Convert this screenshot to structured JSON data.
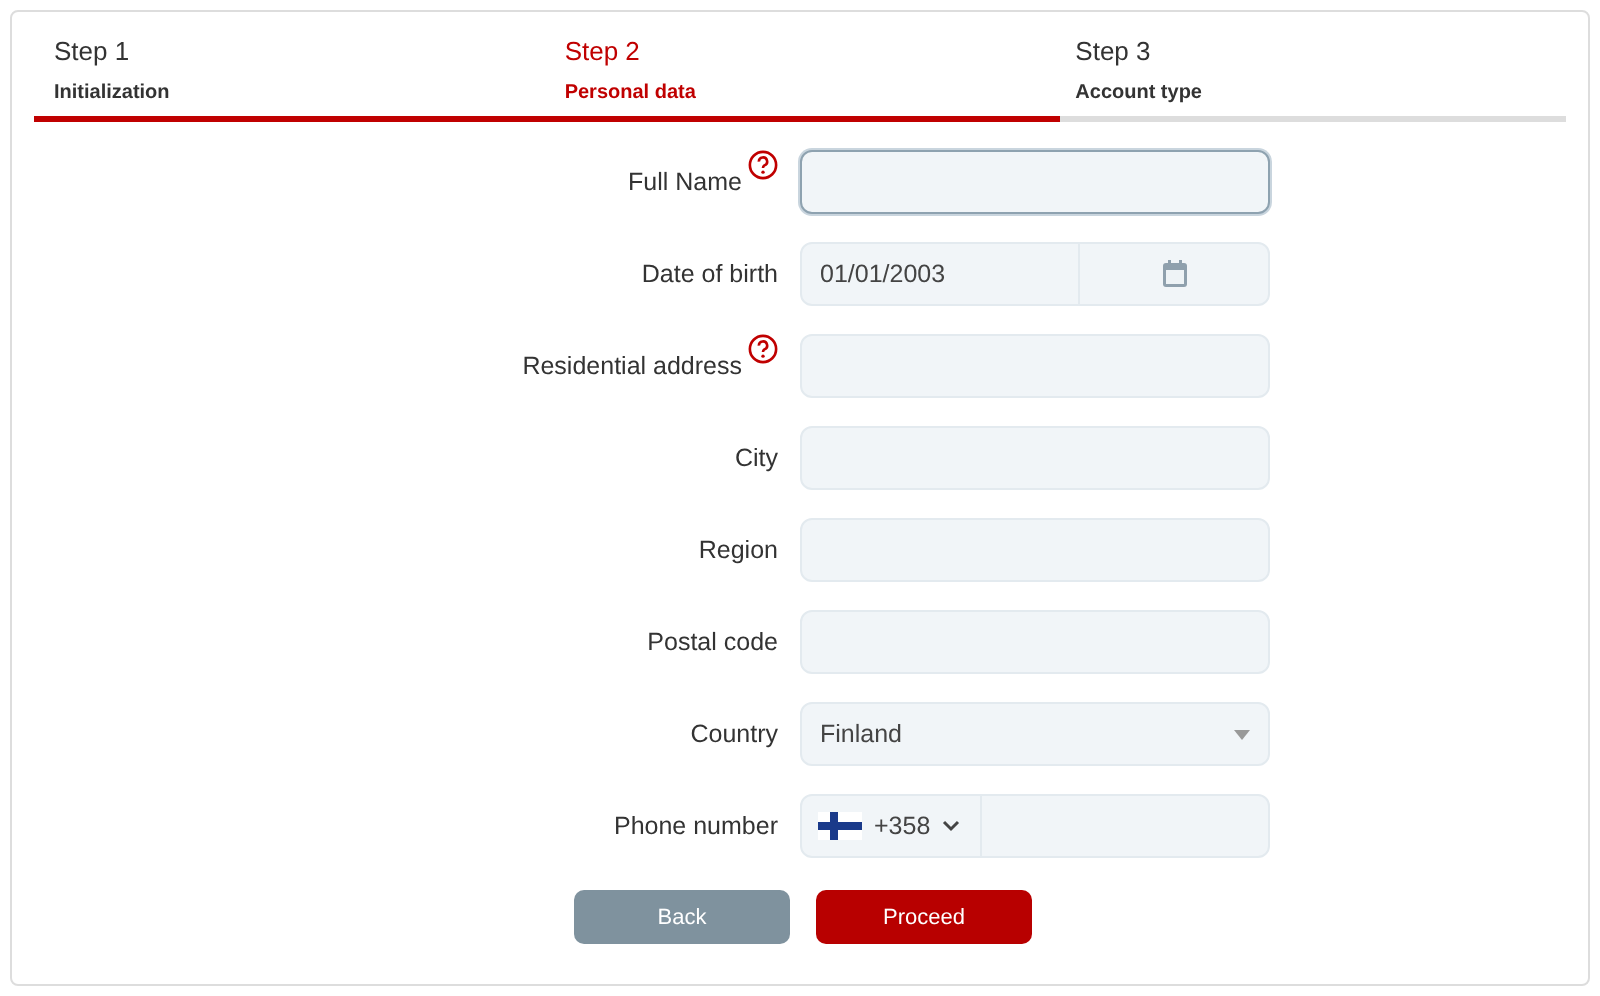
{
  "steps": [
    {
      "title": "Step 1",
      "subtitle": "Initialization",
      "selected": false
    },
    {
      "title": "Step 2",
      "subtitle": "Personal data",
      "selected": true
    },
    {
      "title": "Step 3",
      "subtitle": "Account type",
      "selected": false
    }
  ],
  "progress": {
    "level": 0.67
  },
  "fields": [
    {
      "kind": "text",
      "label": "Full Name",
      "help": true,
      "focused": true
    },
    {
      "kind": "date",
      "label": "Date of birth",
      "help": false,
      "value": "01/01/2003"
    },
    {
      "kind": "text",
      "label": "Residential address",
      "help": true,
      "focused": false
    },
    {
      "kind": "text",
      "label": "City",
      "help": false,
      "focused": false
    },
    {
      "kind": "text",
      "label": "Region",
      "help": false,
      "focused": false
    },
    {
      "kind": "text",
      "label": "Postal code",
      "help": false,
      "focused": false
    },
    {
      "kind": "select",
      "label": "Country",
      "help": false,
      "value": "Finland"
    },
    {
      "kind": "phone",
      "label": "Phone number",
      "help": false,
      "code": "+358"
    }
  ],
  "buttons": [
    {
      "label": "Back",
      "kind": "secondary"
    },
    {
      "label": "Proceed",
      "kind": "primary"
    }
  ]
}
